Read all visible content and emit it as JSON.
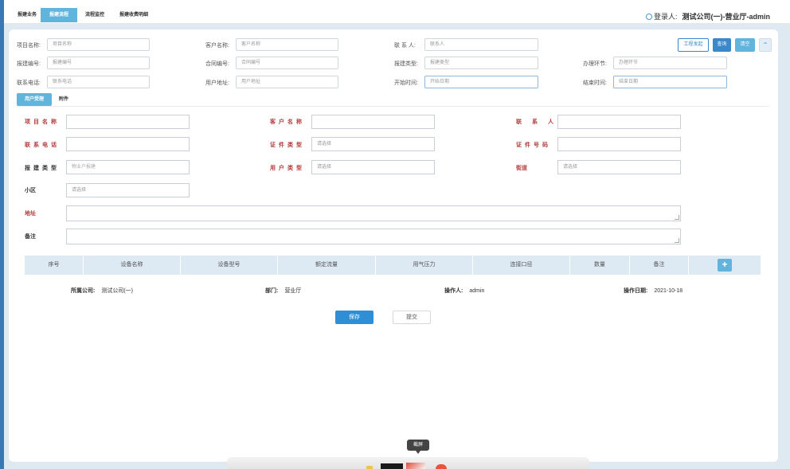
{
  "nav": {
    "tabs": [
      "报建业务",
      "报建流程",
      "流程监控",
      "报建收费明细"
    ],
    "active_tab": "报建流程"
  },
  "header": {
    "login_label": "登录人:",
    "login_user": "测试公司(一)-营业厅-admin"
  },
  "search": {
    "project_name": {
      "label": "项目名称:",
      "placeholder": "项目名称"
    },
    "customer_name": {
      "label": "客户名称:",
      "placeholder": "客户名称"
    },
    "contact": {
      "label": "联 系 人:",
      "placeholder": "联系人"
    },
    "apply_no": {
      "label": "报建编号:",
      "placeholder": "报建编号"
    },
    "contract_no": {
      "label": "合同编号:",
      "placeholder": "合同编号"
    },
    "apply_type": {
      "label": "报建类型:",
      "placeholder": "报建类型"
    },
    "process_step": {
      "label": "办理环节:",
      "placeholder": "办理环节"
    },
    "phone": {
      "label": "联系电话:",
      "placeholder": "联系电话"
    },
    "user_address": {
      "label": "用户地址:",
      "placeholder": "用户地址"
    },
    "start_time": {
      "label": "开始时间:",
      "placeholder": "开始日期"
    },
    "end_time": {
      "label": "结束时间:",
      "placeholder": "结束日期"
    },
    "buttons": {
      "project_launch": "工程发起",
      "query": "查询",
      "clear": "清空",
      "collapse": "⌃"
    }
  },
  "subtabs": [
    "用户受理",
    "附件"
  ],
  "form": {
    "project_name": {
      "label": "项目名称",
      "value": ""
    },
    "customer_name": {
      "label": "客户名称",
      "value": ""
    },
    "contact": {
      "label": "联系人",
      "value": ""
    },
    "phone": {
      "label": "联系电话",
      "value": ""
    },
    "id_type": {
      "label": "证件类型",
      "placeholder": "请选择"
    },
    "id_no": {
      "label": "证件号码",
      "value": ""
    },
    "apply_type": {
      "label": "报建类型",
      "value": "物业户报建"
    },
    "user_type": {
      "label": "用户类型",
      "placeholder": "请选择"
    },
    "street": {
      "label": "街道",
      "placeholder": "请选择"
    },
    "community": {
      "label": "小区",
      "placeholder": "请选择"
    },
    "address": {
      "label": "地址"
    },
    "remark": {
      "label": "备注"
    }
  },
  "table": {
    "columns": [
      "序号",
      "设备名称",
      "设备型号",
      "额定流量",
      "用气压力",
      "连接口径",
      "数量",
      "备注"
    ],
    "add_label": "+"
  },
  "info": {
    "company": {
      "label": "所属公司:",
      "value": "测试公司(一)"
    },
    "department": {
      "label": "部门:",
      "value": "营业厅"
    },
    "operator": {
      "label": "操作人:",
      "value": "admin"
    },
    "date": {
      "label": "操作日期:",
      "value": "2021-10-18"
    }
  },
  "actions": {
    "save": "保存",
    "submit": "提交"
  },
  "tooltip": "截屏",
  "colors": {
    "accent": "#61b5dd",
    "primary": "#2e8fd6",
    "required_label": "#b13b3b"
  }
}
